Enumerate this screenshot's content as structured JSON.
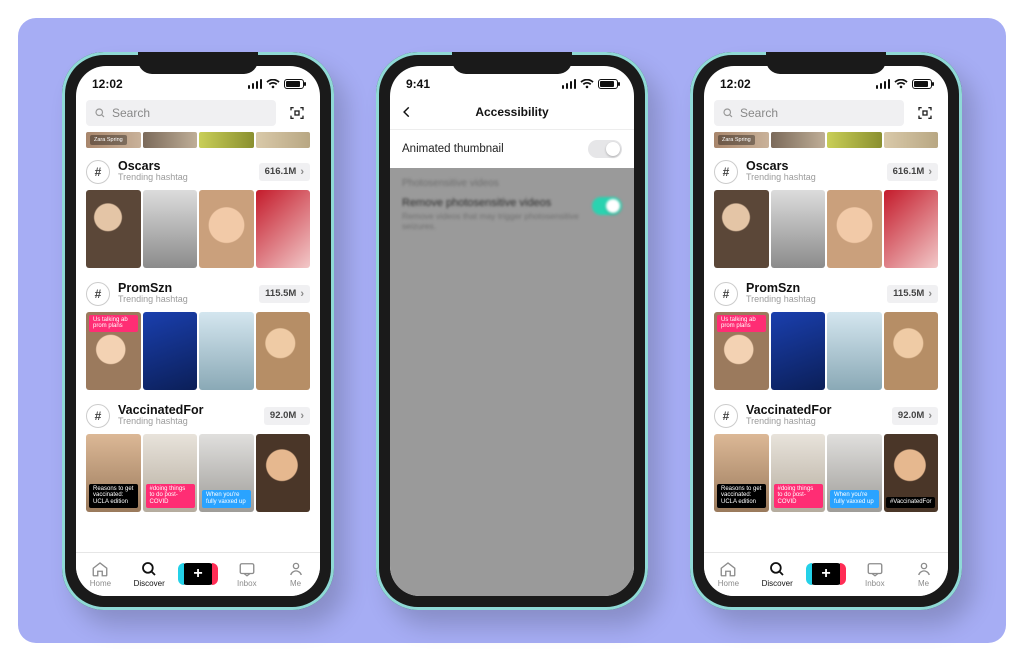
{
  "status": {
    "time_a": "12:02",
    "time_b": "9:41"
  },
  "search": {
    "placeholder": "Search"
  },
  "hero_label": "Zara Spring",
  "hashtags": [
    {
      "name": "Oscars",
      "sub": "Trending hashtag",
      "count": "616.1M"
    },
    {
      "name": "PromSzn",
      "sub": "Trending hashtag",
      "count": "115.5M"
    },
    {
      "name": "VaccinatedFor",
      "sub": "Trending hashtag",
      "count": "92.0M"
    }
  ],
  "badges": {
    "prom_pink": "Us talking ab prom plans",
    "vac_black": "Reasons to get vaccinated: UCLA edition",
    "vac_pink": "#doing things to do post-COVID",
    "vac_blue": "When you're fully vaxxed up",
    "vac_right": "#VaccinatedFor"
  },
  "tabs": {
    "home": "Home",
    "discover": "Discover",
    "inbox": "Inbox",
    "me": "Me"
  },
  "accessibility": {
    "title": "Accessibility",
    "row1": "Animated thumbnail",
    "section": "Photosensitive videos",
    "row2": "Remove photosensitive videos",
    "row2_sub": "Remove videos that may trigger photosensitive seizures."
  }
}
